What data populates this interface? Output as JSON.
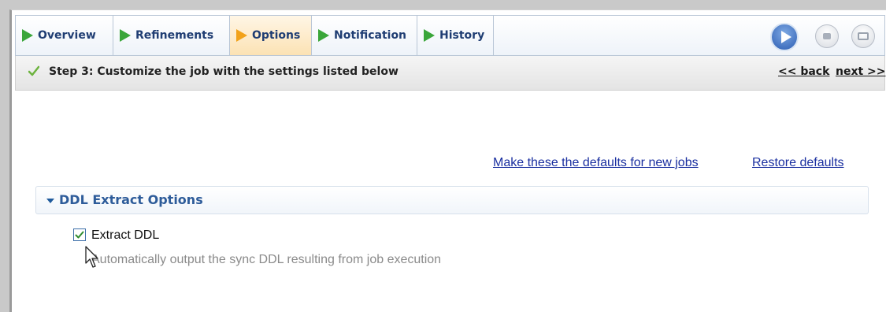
{
  "tabs": [
    {
      "label": "Overview",
      "active": false
    },
    {
      "label": "Refinements",
      "active": false
    },
    {
      "label": "Options",
      "active": true
    },
    {
      "label": "Notification",
      "active": false
    },
    {
      "label": "History",
      "active": false
    }
  ],
  "controls": {
    "run_icon": "play-icon",
    "stop_icon": "stop-icon",
    "console_icon": "console-icon"
  },
  "step": {
    "text": "Step 3: Customize the job with the settings listed below",
    "back_label": "<< back",
    "next_label": "next >>"
  },
  "links": {
    "make_defaults": "Make these the defaults for new jobs",
    "restore_defaults": "Restore defaults"
  },
  "section": {
    "title": "DDL Extract Options",
    "option": {
      "label": "Extract DDL",
      "checked": true,
      "description": "Automatically output the sync DDL resulting from job execution"
    }
  },
  "colors": {
    "tab_arrow": "#3aa63a",
    "active_tab_arrow": "#f2a21a",
    "link": "#1a2fa0",
    "section_title": "#2e5c9a"
  }
}
